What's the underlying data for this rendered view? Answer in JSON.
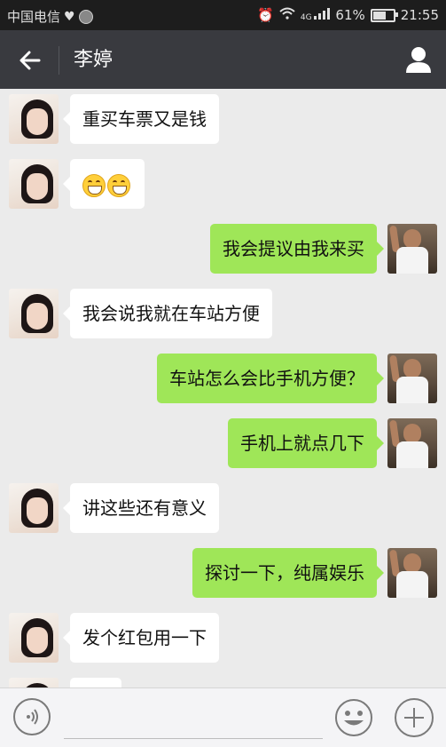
{
  "status_bar": {
    "carrier": "中国电信",
    "battery_percent": "61%",
    "time": "21:55",
    "network": "4G"
  },
  "header": {
    "contact_name": "李婷"
  },
  "messages": [
    {
      "from": "her",
      "text": "重买车票又是钱"
    },
    {
      "from": "her",
      "emoji": [
        "grin-emoji",
        "grin-emoji"
      ]
    },
    {
      "from": "me",
      "text": "我会提议由我来买"
    },
    {
      "from": "her",
      "text": "我会说我就在车站方便"
    },
    {
      "from": "me",
      "text": "车站怎么会比手机方便？"
    },
    {
      "from": "me",
      "text": "手机上就点几下"
    },
    {
      "from": "her",
      "text": "讲这些还有意义"
    },
    {
      "from": "me",
      "text": "探讨一下，纯属娱乐"
    },
    {
      "from": "her",
      "text": "发个红包用一下"
    }
  ],
  "colors": {
    "header_bg": "#393a3f",
    "status_bg": "#1d1d1d",
    "chat_bg": "#ebebeb",
    "outgoing_bubble": "#9fe658",
    "incoming_bubble": "#ffffff"
  }
}
